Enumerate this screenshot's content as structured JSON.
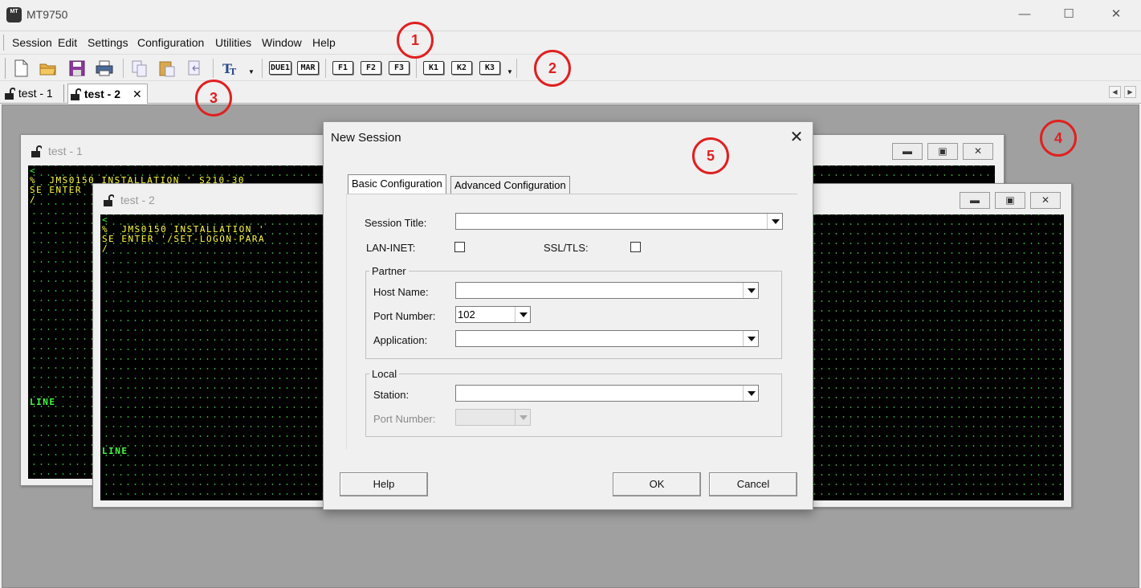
{
  "app": {
    "title": "MT9750",
    "icon_text": "MT"
  },
  "window_controls": {
    "minimize": "—",
    "maximize": "☐",
    "close": "✕"
  },
  "menu": [
    "Session",
    "Edit",
    "Settings",
    "Configuration",
    "Utilities",
    "Window",
    "Help"
  ],
  "toolbar": {
    "icons": [
      "new-file-icon",
      "open-folder-icon",
      "save-icon",
      "print-icon",
      "copy-icon",
      "paste-icon",
      "paste-special-icon",
      "font-icon"
    ],
    "keys_a": [
      "DUE1",
      "MAR"
    ],
    "keys_f": [
      "F1",
      "F2",
      "F3"
    ],
    "keys_k": [
      "K1",
      "K2",
      "K3"
    ],
    "dropdown": "▼"
  },
  "tabs": [
    {
      "label": "test - 1",
      "active": false
    },
    {
      "label": "test - 2",
      "active": true,
      "close": "✕"
    }
  ],
  "tab_scroll": {
    "left": "◀",
    "right": "▶"
  },
  "sessions": [
    {
      "title": "test - 1",
      "lines": [
        "<",
        "%  JMS0150 INSTALLATION ' S210-30",
        "SE ENTER",
        "/"
      ],
      "status": "LINE"
    },
    {
      "title": "test - 2",
      "lines": [
        "<",
        "%  JMS0150 INSTALLATION '",
        "SE ENTER '/SET-LOGON-PARA",
        "/"
      ],
      "status": "LINE"
    }
  ],
  "child_controls": {
    "minimize": "▬",
    "restore": "▣",
    "close": "✕"
  },
  "dialog": {
    "title": "New Session",
    "close": "✕",
    "tabs": [
      "Basic Configuration",
      "Advanced Configuration"
    ],
    "session_title_label": "Session Title:",
    "session_title_value": "",
    "lan_inet_label": "LAN-INET:",
    "ssl_tls_label": "SSL/TLS:",
    "partner": {
      "label": "Partner",
      "host_name_label": "Host Name:",
      "host_name_value": "",
      "port_number_label": "Port Number:",
      "port_number_value": "102",
      "application_label": "Application:",
      "application_value": ""
    },
    "local": {
      "label": "Local",
      "station_label": "Station:",
      "station_value": "",
      "port_number_label": "Port Number:",
      "port_number_value": ""
    },
    "buttons": {
      "help": "Help",
      "ok": "OK",
      "cancel": "Cancel"
    }
  },
  "annotations": [
    "1",
    "2",
    "3",
    "4",
    "5"
  ],
  "colors": {
    "annotation": "#e02020",
    "terminal_bg": "#000000",
    "terminal_yellow": "#ffff40",
    "terminal_green": "#40ff40",
    "mdi_bg": "#a0a0a0"
  }
}
